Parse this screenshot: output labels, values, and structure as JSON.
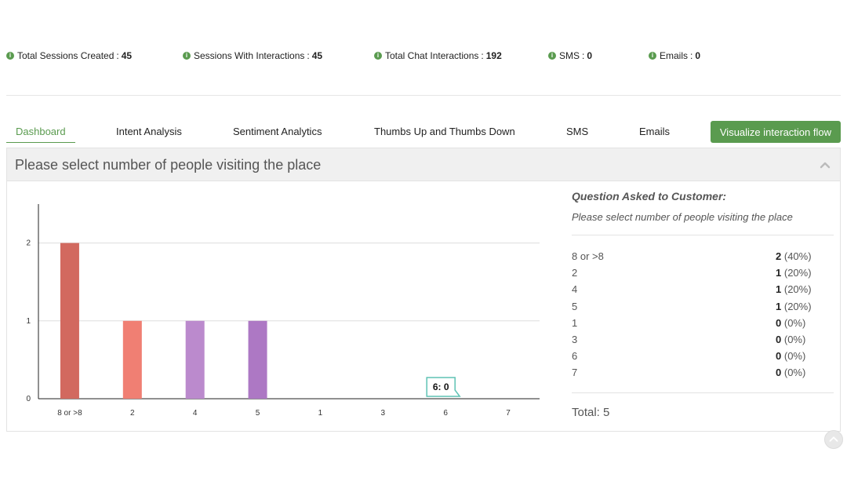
{
  "stats": [
    {
      "label": "Total Sessions Created",
      "value": "45"
    },
    {
      "label": "Sessions With Interactions",
      "value": "45"
    },
    {
      "label": "Total Chat Interactions",
      "value": "192"
    },
    {
      "label": "SMS",
      "value": "0"
    },
    {
      "label": "Emails",
      "value": "0"
    }
  ],
  "stat_separator": ":",
  "tabs": [
    {
      "label": "Dashboard",
      "active": true
    },
    {
      "label": "Intent Analysis"
    },
    {
      "label": "Sentiment Analytics"
    },
    {
      "label": "Thumbs Up and Thumbs Down"
    },
    {
      "label": "SMS"
    },
    {
      "label": "Emails"
    }
  ],
  "visualize_button": "Visualize interaction flow",
  "panel": {
    "title": "Please select number of people visiting the place",
    "question_heading": "Question Asked to Customer:",
    "question_text": "Please select number of people visiting the place",
    "answers": [
      {
        "label": "8 or >8",
        "count": "2",
        "pct": "(40%)"
      },
      {
        "label": "2",
        "count": "1",
        "pct": "(20%)"
      },
      {
        "label": "4",
        "count": "1",
        "pct": "(20%)"
      },
      {
        "label": "5",
        "count": "1",
        "pct": "(20%)"
      },
      {
        "label": "1",
        "count": "0",
        "pct": "(0%)"
      },
      {
        "label": "3",
        "count": "0",
        "pct": "(0%)"
      },
      {
        "label": "6",
        "count": "0",
        "pct": "(0%)"
      },
      {
        "label": "7",
        "count": "0",
        "pct": "(0%)"
      }
    ],
    "total": "Total: 5"
  },
  "chart_data": {
    "type": "bar",
    "categories": [
      "8 or >8",
      "2",
      "4",
      "5",
      "1",
      "3",
      "6",
      "7"
    ],
    "values": [
      2,
      1,
      1,
      1,
      0,
      0,
      0,
      0
    ],
    "colors": [
      "#d2695f",
      "#f07f73",
      "#bb8acd",
      "#ad78c4",
      "#6aa9d9",
      "#5ec2b4",
      "#5ec2b4",
      "#f0b552"
    ],
    "yticks": [
      0,
      1,
      2
    ],
    "ylim": [
      0,
      2.5
    ],
    "grid": true,
    "tooltip": {
      "category": "6",
      "text": "6: 0",
      "border_color": "#5ec2b4"
    }
  },
  "colors": {
    "accent": "#5a9b4f",
    "info_icon": "#5a9b4f"
  },
  "icons": {
    "stat": "info-circle-icon",
    "collapse": "chevron-up-icon",
    "scroll": "scroll-top-icon"
  }
}
